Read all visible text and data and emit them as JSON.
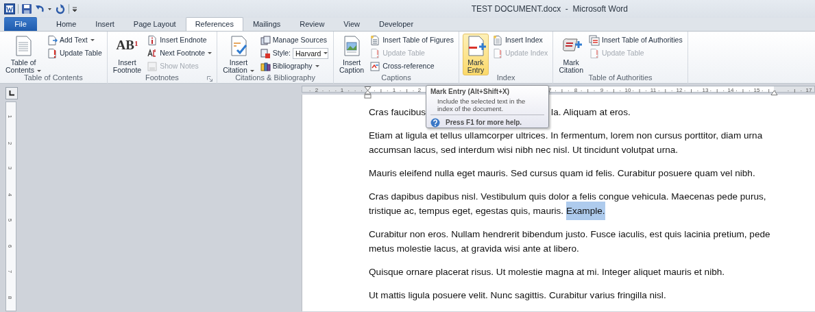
{
  "window": {
    "title": "TEST DOCUMENT.docx  -  Microsoft Word"
  },
  "tabs": [
    {
      "label": "File",
      "kind": "file",
      "selected": false
    },
    {
      "label": "Home",
      "kind": "tab",
      "selected": false
    },
    {
      "label": "Insert",
      "kind": "tab",
      "selected": false
    },
    {
      "label": "Page Layout",
      "kind": "tab",
      "selected": false
    },
    {
      "label": "References",
      "kind": "tab",
      "selected": true
    },
    {
      "label": "Mailings",
      "kind": "tab",
      "selected": false
    },
    {
      "label": "Review",
      "kind": "tab",
      "selected": false
    },
    {
      "label": "View",
      "kind": "tab",
      "selected": false
    },
    {
      "label": "Developer",
      "kind": "tab",
      "selected": false
    }
  ],
  "ribbon": {
    "groups": [
      {
        "label": "Table of Contents",
        "launcher": false,
        "items": [
          {
            "kind": "large",
            "label": "Table of\nContents",
            "dropdown": true,
            "disabled": false,
            "highlighted": false
          },
          {
            "kind": "small",
            "label": "Add Text",
            "dropdown": true,
            "disabled": false,
            "highlighted": false
          },
          {
            "kind": "small",
            "label": "Update Table",
            "dropdown": false,
            "disabled": false,
            "highlighted": false
          }
        ]
      },
      {
        "label": "Footnotes",
        "launcher": true,
        "items": [
          {
            "kind": "large",
            "label": "Insert\nFootnote",
            "glyph": "AB$^{1}$",
            "dropdown": false,
            "disabled": false,
            "highlighted": false
          },
          {
            "kind": "small",
            "label": "Insert Endnote",
            "dropdown": false,
            "disabled": false,
            "highlighted": false
          },
          {
            "kind": "small",
            "label": "Next Footnote",
            "dropdown": true,
            "disabled": false,
            "highlighted": false
          },
          {
            "kind": "small",
            "label": "Show Notes",
            "dropdown": false,
            "disabled": true,
            "highlighted": false
          }
        ]
      },
      {
        "label": "Citations & Bibliography",
        "launcher": false,
        "items": [
          {
            "kind": "large",
            "label": "Insert\nCitation",
            "dropdown": true,
            "disabled": false,
            "highlighted": false
          },
          {
            "kind": "small",
            "label": "Manage Sources",
            "dropdown": false,
            "disabled": false,
            "highlighted": false
          },
          {
            "kind": "combo",
            "label": "Style:",
            "value": "Harvard",
            "dropdown": true,
            "disabled": false
          },
          {
            "kind": "small",
            "label": "Bibliography",
            "dropdown": true,
            "disabled": false,
            "highlighted": false
          }
        ]
      },
      {
        "label": "Captions",
        "launcher": false,
        "items": [
          {
            "kind": "large",
            "label": "Insert\nCaption",
            "dropdown": false,
            "disabled": false,
            "highlighted": false
          },
          {
            "kind": "small",
            "label": "Insert Table of Figures",
            "dropdown": false,
            "disabled": false,
            "highlighted": false
          },
          {
            "kind": "small",
            "label": "Update Table",
            "dropdown": false,
            "disabled": true,
            "highlighted": false
          },
          {
            "kind": "small",
            "label": "Cross-reference",
            "dropdown": false,
            "disabled": false,
            "highlighted": false
          }
        ]
      },
      {
        "label": "Index",
        "launcher": false,
        "items": [
          {
            "kind": "large",
            "label": "Mark\nEntry",
            "dropdown": false,
            "disabled": false,
            "highlighted": true
          },
          {
            "kind": "small",
            "label": "Insert Index",
            "dropdown": false,
            "disabled": false,
            "highlighted": false
          },
          {
            "kind": "small",
            "label": "Update Index",
            "dropdown": false,
            "disabled": true,
            "highlighted": false
          }
        ]
      },
      {
        "label": "Table of Authorities",
        "launcher": false,
        "items": [
          {
            "kind": "large",
            "label": "Mark\nCitation",
            "dropdown": false,
            "disabled": false,
            "highlighted": false
          },
          {
            "kind": "small",
            "label": "Insert Table of Authorities",
            "dropdown": false,
            "disabled": false,
            "highlighted": false
          },
          {
            "kind": "small",
            "label": "Update Table",
            "dropdown": false,
            "disabled": true,
            "highlighted": false
          }
        ]
      }
    ]
  },
  "horizontal_ruler": {
    "labels": [
      "2",
      "1",
      "1",
      "2",
      "7",
      "8",
      "9",
      "10",
      "11",
      "12",
      "13",
      "14",
      "15",
      "17"
    ]
  },
  "vertical_ruler": {
    "labels": [
      "1",
      "2",
      "3",
      "4",
      "5",
      "6",
      "7",
      "8"
    ]
  },
  "tooltip": {
    "title": "Mark Entry (Alt+Shift+X)",
    "body": "Include the selected text in the index of the document.",
    "help": "Press F1 for more help."
  },
  "document": {
    "paragraphs": [
      {
        "kind": "covered",
        "parts": [
          "Cras faucibus",
          "la. Aliquam at eros."
        ]
      },
      {
        "kind": "text",
        "text": "Etiam at ligula et tellus ullamcorper ultrices. In fermentum, lorem non cursus porttitor, diam urna accumsan lacus, sed interdum wisi nibh nec nisl. Ut tincidunt volutpat urna."
      },
      {
        "kind": "text",
        "text": "Mauris eleifend nulla eget mauris. Sed cursus quam id felis. Curabitur posuere quam vel nibh."
      },
      {
        "kind": "text",
        "text": "Cras dapibus dapibus nisl. Vestibulum quis dolor a felis congue vehicula. Maecenas pede purus, tristique ac, tempus eget, egestas quis, mauris.",
        "selected_text": "Example."
      },
      {
        "kind": "text",
        "text": "Curabitur non eros. Nullam hendrerit bibendum justo. Fusce iaculis, est quis lacinia pretium, pede metus molestie lacus, at gravida wisi ante at libero."
      },
      {
        "kind": "text",
        "text": "Quisque ornare placerat risus. Ut molestie magna at mi. Integer aliquet mauris et nibh."
      },
      {
        "kind": "text",
        "text": "Ut mattis ligula posuere velit. Nunc sagittis. Curabitur varius fringilla nisl."
      }
    ]
  }
}
